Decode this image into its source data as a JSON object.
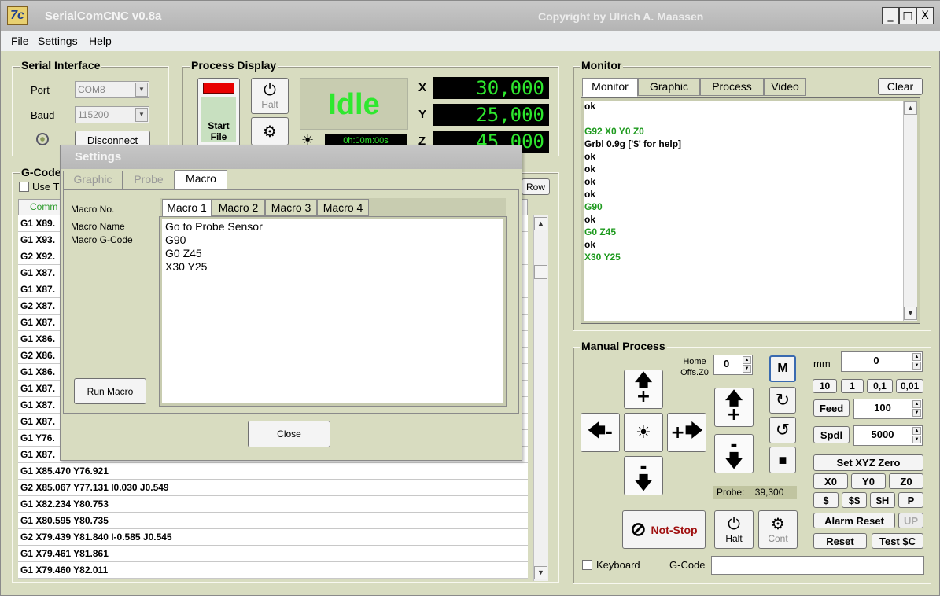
{
  "window": {
    "title": "SerialComCNC  v0.8a",
    "copyright": "Copyright by Ulrich A. Maassen",
    "logo_text": "7c",
    "minimize": "_",
    "maximize": "□",
    "close": "X"
  },
  "menu": [
    "File",
    "Settings",
    "Help"
  ],
  "serial": {
    "title": "Serial Interface",
    "port_label": "Port",
    "port_value": "COM8",
    "baud_label": "Baud",
    "baud_value": "115200",
    "disconnect": "Disconnect"
  },
  "process": {
    "title": "Process Display",
    "start_file": "Start File",
    "halt": "Halt",
    "state": "Idle",
    "timer": "0h:00m:00s",
    "x_label": "X",
    "x_value": "30,000",
    "y_label": "Y",
    "y_value": "25,000",
    "z_label": "Z",
    "z_value": "45,000"
  },
  "gcode": {
    "title": "G-Code",
    "use_label": "Use T",
    "col_header": "Comm",
    "row_button": "Row",
    "rows_truncated": [
      "G1 X89.",
      "G1 X93.",
      "G2 X92.",
      "G1 X87.",
      "G1 X87.",
      "G2 X87.",
      "G1 X87.",
      "G1 X86.",
      "G2 X86.",
      "G1 X86.",
      "G1 X87.",
      "G1 X87.",
      "G1 X87.",
      "G1 Y76.",
      "G1 X87."
    ],
    "rows_full": [
      "G1 X85.470 Y76.921",
      "G2 X85.067 Y77.131 I0.030 J0.549",
      "G1 X82.234 Y80.753",
      "G1 X80.595 Y80.735",
      "G2 X79.439 Y81.840 I-0.585 J0.545",
      "G1 X79.461 Y81.861",
      "G1 X79.460 Y82.011"
    ]
  },
  "monitor": {
    "title": "Monitor",
    "tabs": [
      "Monitor",
      "Graphic",
      "Process",
      "Video"
    ],
    "clear": "Clear",
    "lines": [
      {
        "text": "ok",
        "color": "#000000"
      },
      {
        "text": "",
        "color": "#000000"
      },
      {
        "text": "G92 X0 Y0 Z0",
        "color": "#1e9a1e"
      },
      {
        "text": "Grbl 0.9g ['$' for help]",
        "color": "#000000"
      },
      {
        "text": "ok",
        "color": "#000000"
      },
      {
        "text": "ok",
        "color": "#000000"
      },
      {
        "text": "ok",
        "color": "#000000"
      },
      {
        "text": "ok",
        "color": "#000000"
      },
      {
        "text": "G90",
        "color": "#1e9a1e"
      },
      {
        "text": "ok",
        "color": "#000000"
      },
      {
        "text": "G0 Z45",
        "color": "#1e9a1e"
      },
      {
        "text": "ok",
        "color": "#000000"
      },
      {
        "text": "X30 Y25",
        "color": "#1e9a1e"
      }
    ]
  },
  "manual": {
    "title": "Manual Process",
    "home_label": "Home",
    "offs_label": "Offs.Z0",
    "home_value": "0",
    "m_button": "M",
    "mm_label": "mm",
    "mm_value": "0",
    "steps": [
      "10",
      "1",
      "0,1",
      "0,01"
    ],
    "feed_label": "Feed",
    "feed_value": "100",
    "spdl_label": "Spdl",
    "spdl_value": "5000",
    "set_zero": "Set XYZ Zero",
    "zero_buttons": [
      "X0",
      "Y0",
      "Z0"
    ],
    "cmd_buttons": [
      "$",
      "$$",
      "$H",
      "P"
    ],
    "alarm_reset": "Alarm Reset",
    "up": "UP",
    "reset": "Reset",
    "test": "Test $C",
    "probe_label": "Probe:",
    "probe_value": "39,300",
    "not_stop": "Not-Stop",
    "halt": "Halt",
    "cont": "Cont",
    "keyboard": "Keyboard",
    "gcode_label": "G-Code",
    "left_minus": "-",
    "right_plus": "+",
    "up_plus": "+",
    "down_minus": "-"
  },
  "settings": {
    "title": "Settings",
    "tabs": [
      "Graphic",
      "Probe",
      "Macro"
    ],
    "macro_no": "Macro No.",
    "macro_name": "Macro Name",
    "macro_gcode": "Macro G-Code",
    "macro_tabs": [
      "Macro 1",
      "Macro 2",
      "Macro 3",
      "Macro 4"
    ],
    "macro_lines": [
      "Go to Probe Sensor",
      "G90",
      "G0 Z45",
      "X30 Y25"
    ],
    "run_macro": "Run Macro",
    "close": "Close"
  },
  "colors": {
    "panel": "#d8dcc0",
    "lcd_text": "#2ee82e",
    "idle_bg": "#c8ccb0",
    "idle_text": "#2ee82e",
    "monitor_green": "#1e9a1e",
    "not_stop_red": "#a01010",
    "start_red": "#e80000"
  }
}
